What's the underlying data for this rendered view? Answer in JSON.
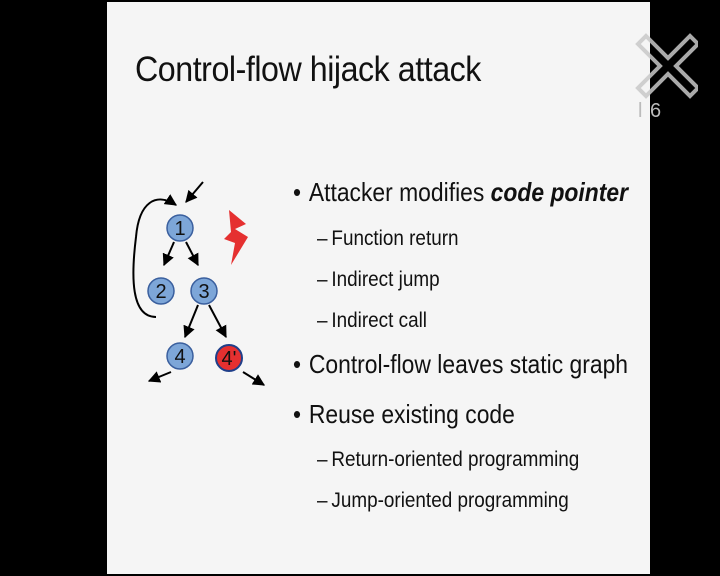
{
  "slide": {
    "title": "Control-flow hijack attack",
    "bullets": [
      {
        "level": 1,
        "text": "Attacker modifies ",
        "emph": "code pointer"
      },
      {
        "level": 2,
        "text": "Function return"
      },
      {
        "level": 2,
        "text": "Indirect jump"
      },
      {
        "level": 2,
        "text": "Indirect call"
      },
      {
        "level": 1,
        "text": "Control-flow leaves static graph"
      },
      {
        "level": 1,
        "text": "Reuse existing code"
      },
      {
        "level": 2,
        "text": "Return-oriented programming"
      },
      {
        "level": 2,
        "text": "Jump-oriented programming"
      }
    ]
  },
  "graph": {
    "nodes": [
      "1",
      "2",
      "3",
      "4",
      "4'"
    ],
    "node_color": "#7da6d8",
    "attacked_node_color": "#e53030",
    "lightning_color": "#e53030"
  },
  "watermark": {
    "text": "l 6"
  }
}
